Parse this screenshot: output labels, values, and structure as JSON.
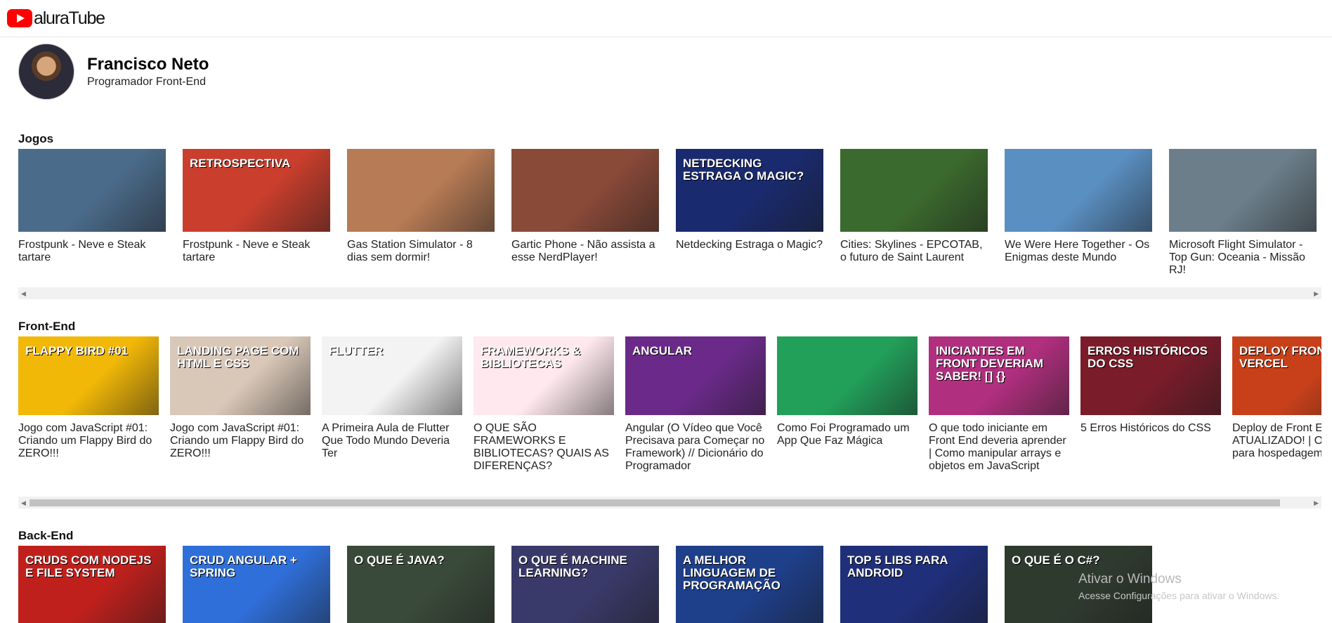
{
  "app": {
    "logo_text": "aluraTube"
  },
  "profile": {
    "name": "Francisco Neto",
    "role": "Programador Front-End"
  },
  "sections": [
    {
      "title": "Jogos",
      "videos": [
        {
          "title": "Frostpunk - Neve e Steak tartare",
          "thumb_color": "#4b6b8a",
          "thumb_text": ""
        },
        {
          "title": "Frostpunk - Neve e Steak tartare",
          "thumb_color": "#c93e2c",
          "thumb_text": "RETROSPECTIVA"
        },
        {
          "title": "Gas Station Simulator - 8 dias sem dormir!",
          "thumb_color": "#b77b55",
          "thumb_text": ""
        },
        {
          "title": "Gartic Phone - Não assista a esse NerdPlayer!",
          "thumb_color": "#8a4a38",
          "thumb_text": ""
        },
        {
          "title": "Netdecking Estraga o Magic?",
          "thumb_color": "#1a2a6e",
          "thumb_text": "NETDECKING ESTRAGA O MAGIC?"
        },
        {
          "title": "Cities: Skylines - EPCOTAB, o futuro de Saint Laurent",
          "thumb_color": "#3b6a2e",
          "thumb_text": ""
        },
        {
          "title": "We Were Here Together - Os Enigmas deste Mundo",
          "thumb_color": "#5a8fc2",
          "thumb_text": ""
        },
        {
          "title": "Microsoft Flight Simulator - Top Gun: Oceania - Missão RJ!",
          "thumb_color": "#6c7e8a",
          "thumb_text": ""
        }
      ]
    },
    {
      "title": "Front-End",
      "videos": [
        {
          "title": "Jogo com JavaScript #01: Criando um Flappy Bird do ZERO!!!",
          "thumb_color": "#f2b807",
          "thumb_text": "Flappy Bird #01"
        },
        {
          "title": "Jogo com JavaScript #01: Criando um Flappy Bird do ZERO!!!",
          "thumb_color": "#d9c8b8",
          "thumb_text": "LANDING PAGE COM HTML E CSS"
        },
        {
          "title": "A Primeira Aula de Flutter Que Todo Mundo Deveria Ter",
          "thumb_color": "#f3f3f3",
          "thumb_text": "Flutter"
        },
        {
          "title": "O QUE SÃO FRAMEWORKS E BIBLIOTECAS? QUAIS AS DIFERENÇAS?",
          "thumb_color": "#ffe9ee",
          "thumb_text": "FRAMEWORKS & BIBLIOTECAS"
        },
        {
          "title": "Angular (O Vídeo que Você Precisava para Começar no Framework) // Dicionário do Programador",
          "thumb_color": "#6b2a8a",
          "thumb_text": "ANGULAR"
        },
        {
          "title": "Como Foi Programado um App Que Faz Mágica",
          "thumb_color": "#22a05a",
          "thumb_text": ""
        },
        {
          "title": "O que todo iniciante em Front End deveria aprender | Como manipular arrays e objetos em JavaScript",
          "thumb_color": "#b02f7e",
          "thumb_text": "INICIANTES EM FRONT DEVERIAM SABER! [] {}"
        },
        {
          "title": "5 Erros Históricos do CSS",
          "thumb_color": "#7a1c2a",
          "thumb_text": "ERROS HISTÓRICOS DO CSS"
        },
        {
          "title": "Deploy de Front E ATUALIZADO! | O eu uso para hospedagem de F End",
          "thumb_color": "#c8401a",
          "thumb_text": "DEPLOY FRONT EN VERCEL"
        }
      ]
    },
    {
      "title": "Back-End",
      "videos": [
        {
          "title": "",
          "thumb_color": "#c0201c",
          "thumb_text": "CRUDS COM NODEJS E FILE SYSTEM"
        },
        {
          "title": "",
          "thumb_color": "#2f6fd9",
          "thumb_text": "CRUD ANGULAR + SPRING"
        },
        {
          "title": "",
          "thumb_color": "#3a4a3a",
          "thumb_text": "O QUE É JAVA?"
        },
        {
          "title": "",
          "thumb_color": "#3a3a6a",
          "thumb_text": "O QUE É MACHINE LEARNING?"
        },
        {
          "title": "",
          "thumb_color": "#1e3f8a",
          "thumb_text": "A MELHOR LINGUAGEM DE PROGRAMAÇÃO"
        },
        {
          "title": "",
          "thumb_color": "#1f2f7a",
          "thumb_text": "TOP 5 LIBS PARA ANDROID"
        },
        {
          "title": "",
          "thumb_color": "#2f3a2f",
          "thumb_text": "O QUE É O C#?"
        }
      ]
    }
  ],
  "watermark": {
    "title": "Ativar o Windows",
    "subtitle": "Acesse Configurações para ativar o Windows."
  }
}
